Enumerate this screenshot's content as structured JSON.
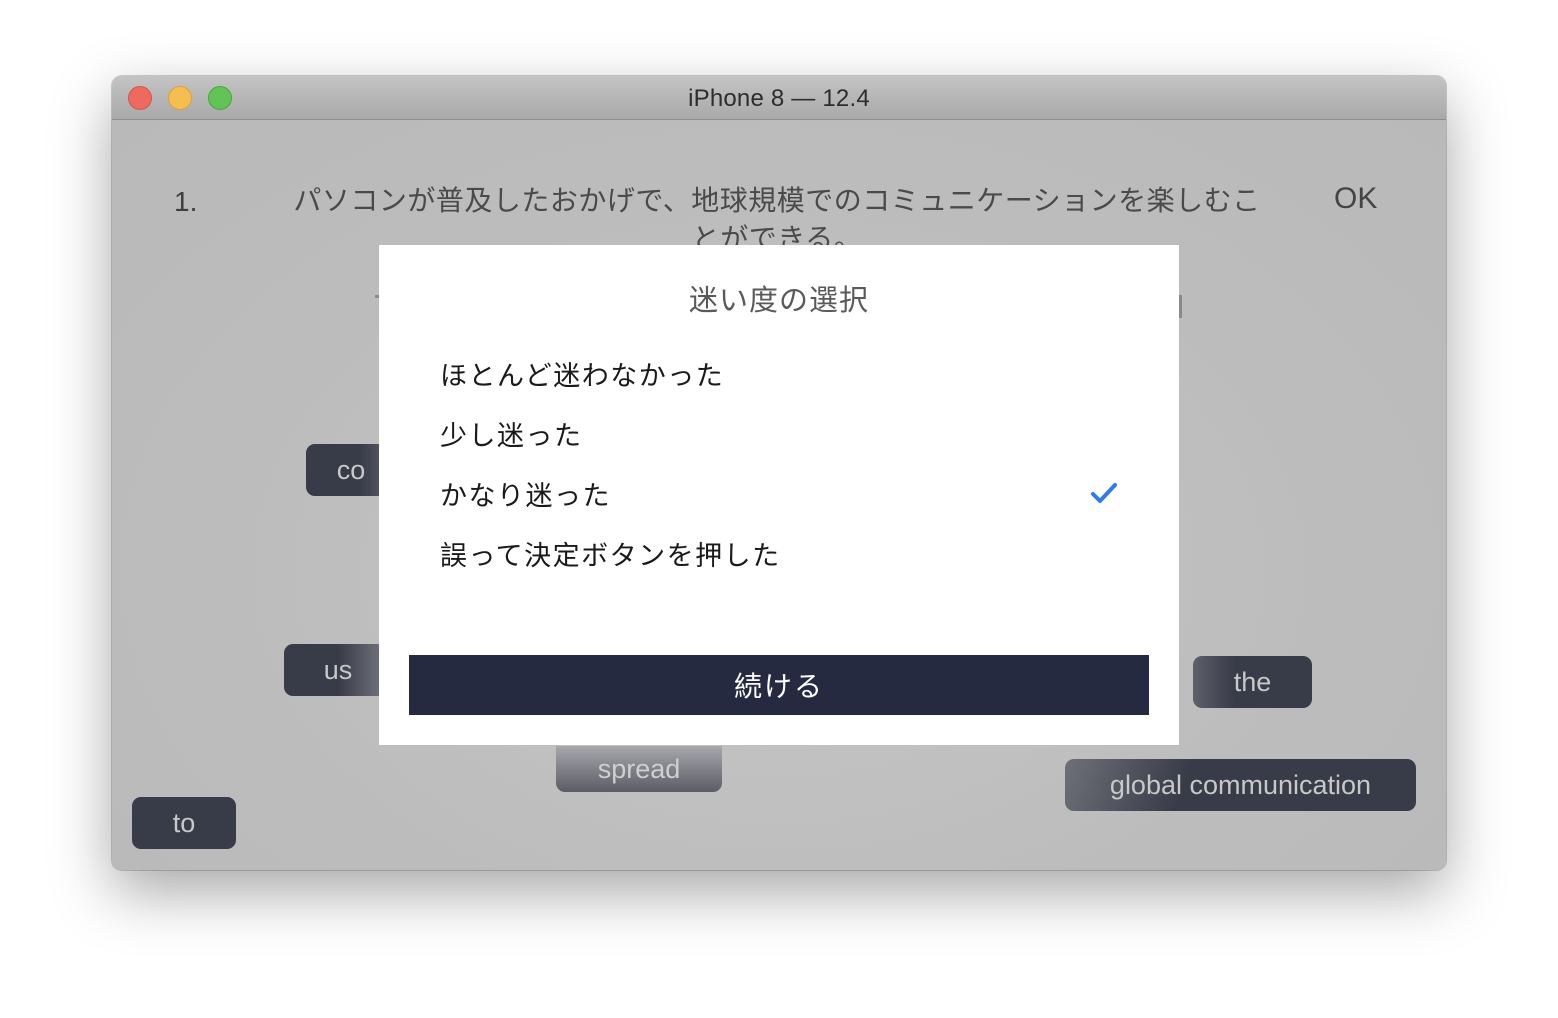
{
  "window": {
    "title": "iPhone 8 — 12.4"
  },
  "question": {
    "number": "1.",
    "text": "パソコンが普及したおかげで、地球規模でのコミュニケーションを楽しむことができる。",
    "ok_label": "OK"
  },
  "word_chips": [
    {
      "label": "co"
    },
    {
      "label": "us"
    },
    {
      "label": "the"
    },
    {
      "label": "spread"
    },
    {
      "label": "global communication"
    },
    {
      "label": "to"
    }
  ],
  "dialog": {
    "title": "迷い度の選択",
    "options": [
      {
        "label": "ほとんど迷わなかった",
        "selected": false
      },
      {
        "label": "少し迷った",
        "selected": false
      },
      {
        "label": "かなり迷った",
        "selected": true
      },
      {
        "label": "誤って決定ボタンを押した",
        "selected": false
      }
    ],
    "continue_label": "続ける",
    "check_color": "#2d7bf2"
  }
}
